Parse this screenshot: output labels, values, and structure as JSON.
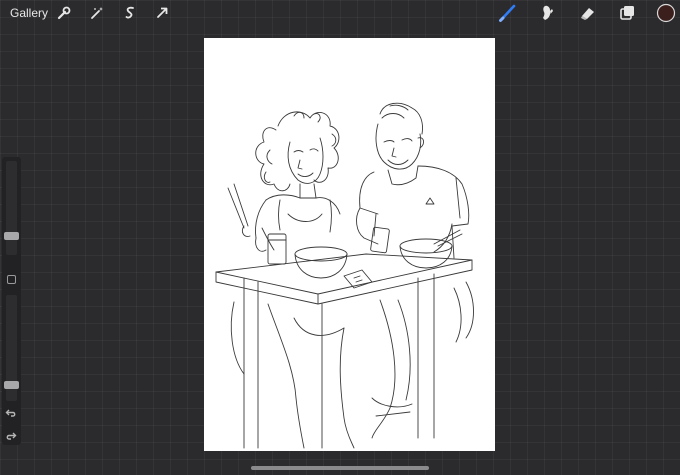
{
  "topbar": {
    "gallery_label": "Gallery",
    "left_tools": [
      "wrench-icon",
      "magic-wand-icon",
      "selection-icon",
      "transform-arrow-icon"
    ],
    "right_tools": [
      "brush-icon",
      "smudge-icon",
      "eraser-icon",
      "layers-icon",
      "color-swatch"
    ]
  },
  "colors": {
    "brush_active": "#2f7cf6",
    "current_color": "#3a1f1c",
    "background": "#2b2b2d",
    "canvas": "#ffffff"
  },
  "sidebar": {
    "brush_size": 0.18,
    "opacity": 0.12,
    "controls": [
      "undo-icon",
      "redo-icon"
    ]
  }
}
